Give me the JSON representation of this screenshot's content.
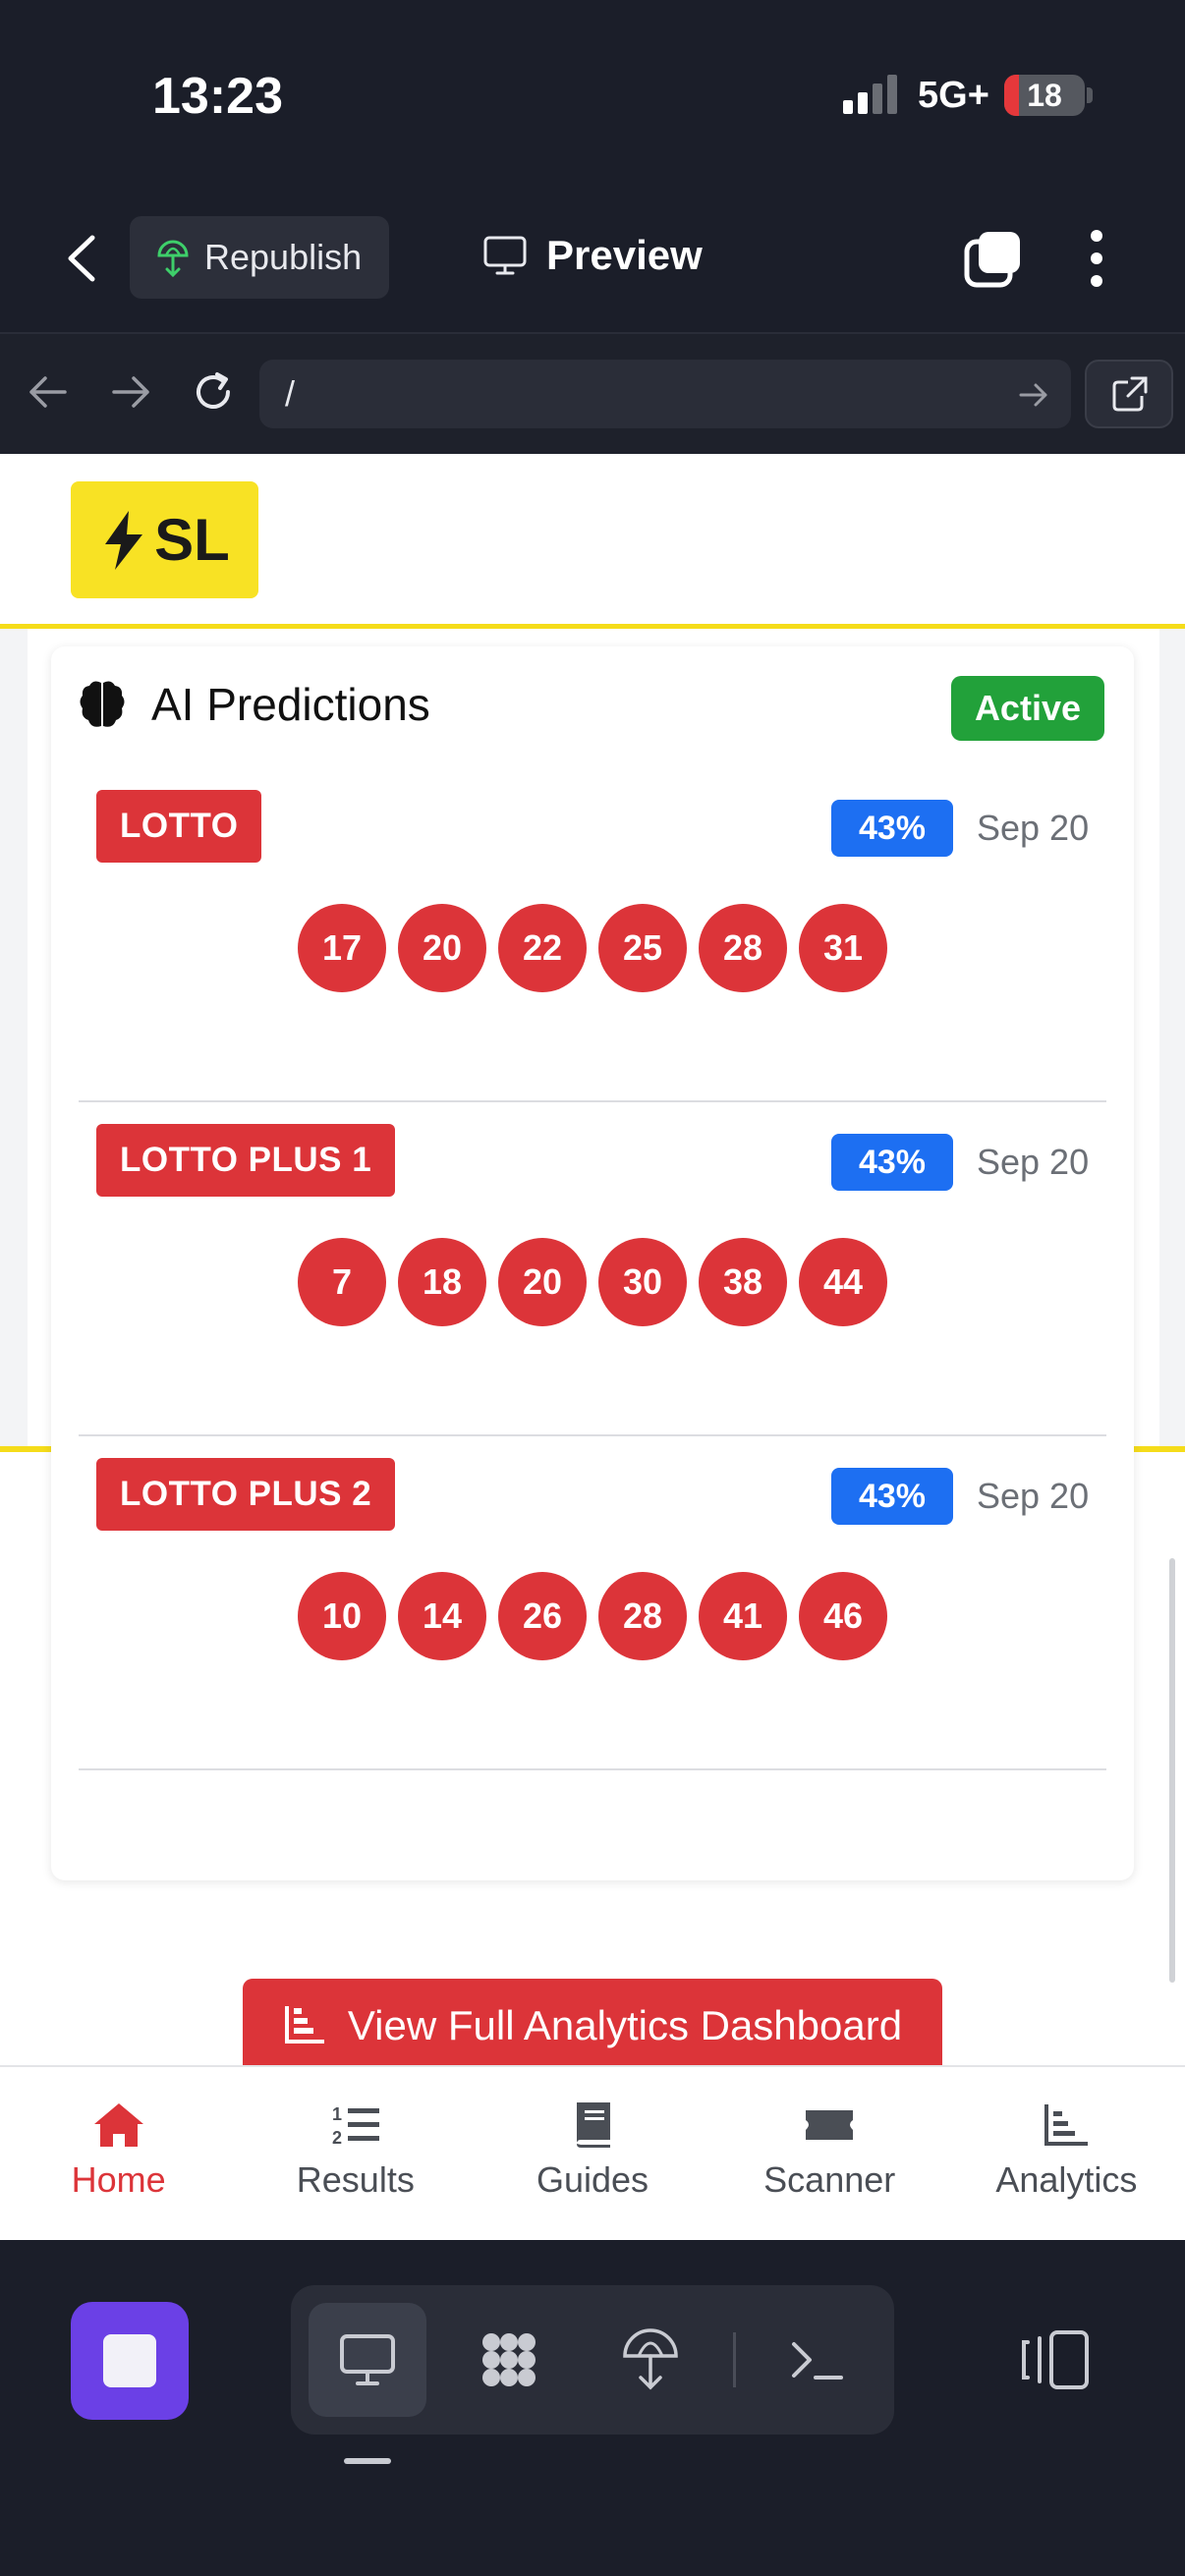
{
  "status_bar": {
    "time": "13:23",
    "network": "5G+",
    "battery": "18",
    "battery_level": 0.18,
    "signal_bars_filled": 2
  },
  "toolbar": {
    "republish_label": "Republish",
    "preview_label": "Preview"
  },
  "url_bar": {
    "url": "/"
  },
  "site": {
    "logo_text": "SL",
    "predictions_card": {
      "title": "AI Predictions",
      "status_badge": "Active",
      "predictions": [
        {
          "game": "LOTTO",
          "confidence": "43%",
          "date": "Sep 20",
          "numbers": [
            "17",
            "20",
            "22",
            "25",
            "28",
            "31"
          ]
        },
        {
          "game": "LOTTO PLUS 1",
          "confidence": "43%",
          "date": "Sep 20",
          "numbers": [
            "7",
            "18",
            "20",
            "30",
            "38",
            "44"
          ]
        },
        {
          "game": "LOTTO PLUS 2",
          "confidence": "43%",
          "date": "Sep 20",
          "numbers": [
            "10",
            "14",
            "26",
            "28",
            "41",
            "46"
          ]
        }
      ]
    },
    "analytics_button": "View Full Analytics Dashboard"
  },
  "bottom_nav": {
    "items": [
      {
        "label": "Home",
        "icon": "home-icon",
        "active": true
      },
      {
        "label": "Results",
        "icon": "numbered-list-icon",
        "active": false
      },
      {
        "label": "Guides",
        "icon": "book-icon",
        "active": false
      },
      {
        "label": "Scanner",
        "icon": "ticket-icon",
        "active": false
      },
      {
        "label": "Analytics",
        "icon": "chart-icon",
        "active": false
      }
    ]
  },
  "colors": {
    "accent_red": "#dc3439",
    "active_green": "#22a13a",
    "confidence_blue": "#1d6ff2",
    "brand_yellow": "#f8e224",
    "dark_bg": "#1b1e29",
    "stop_purple": "#6b40e6"
  }
}
